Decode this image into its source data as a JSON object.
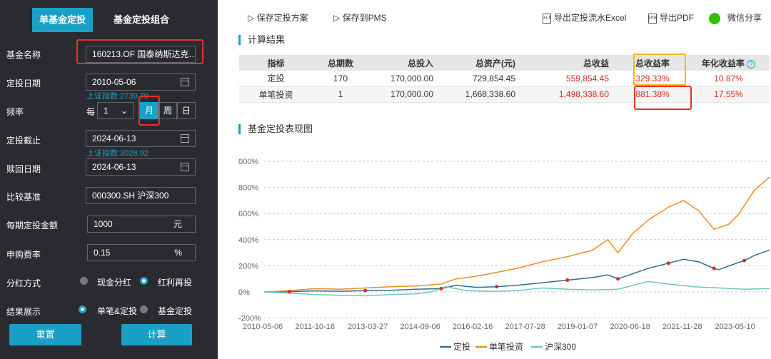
{
  "left": {
    "tabs": [
      "单基金定投",
      "基金定投组合"
    ],
    "fund_name": {
      "label": "基金名称",
      "value": "160213.OF 国泰纳斯达克…"
    },
    "start_date": {
      "label": "定投日期",
      "value": "2010-05-06",
      "hint": "上证指数:2739.70"
    },
    "frequency": {
      "label": "频率",
      "prefix": "每",
      "count": "1",
      "options": [
        "月",
        "周",
        "日"
      ],
      "selected": "月"
    },
    "end_date": {
      "label": "定投截止",
      "value": "2024-06-13",
      "hint": "上证指数:3028.92"
    },
    "redeem_date": {
      "label": "赎回日期",
      "value": "2024-06-13"
    },
    "benchmark": {
      "label": "比较基准",
      "value": "000300.SH 沪深300"
    },
    "amount": {
      "label": "每期定投金额",
      "value": "1000",
      "unit": "元"
    },
    "fee": {
      "label": "申购费率",
      "value": "0.15",
      "unit": "%"
    },
    "dividend": {
      "label": "分红方式",
      "options": [
        "现金分红",
        "红利再投"
      ],
      "selected": 1
    },
    "display": {
      "label": "结果展示",
      "options": [
        "单笔&定投",
        "基金定投"
      ],
      "selected": 0
    },
    "reset": "重置",
    "calc": "计算"
  },
  "toolbar": {
    "save_plan": "保存定投方案",
    "save_pms": "保存到PMS",
    "export_excel": "导出定投流水Excel",
    "export_pdf": "导出PDF",
    "wechat": "微信分享"
  },
  "results": {
    "title": "计算结果",
    "headers": [
      "指标",
      "总期数",
      "总投入",
      "总资产(元)",
      "总收益",
      "总收益率",
      "年化收益率"
    ],
    "rows": [
      [
        "定投",
        "170",
        "170,000.00",
        "729,854.45",
        "559,854.45",
        "329.33%",
        "10.87%"
      ],
      [
        "单笔投资",
        "1",
        "170,000.00",
        "1,668,338.60",
        "1,498,338.60",
        "881.38%",
        "17.55%"
      ]
    ]
  },
  "chart_title": "基金定投表现图",
  "colors": {
    "accent": "#1aa0c4",
    "dca": "#2e6f96",
    "lump": "#f28b1e",
    "hs300": "#6cc5c0",
    "red": "#d9282a"
  },
  "chart_data": {
    "type": "line",
    "y_ticks": [
      "800%",
      "600%",
      "400%",
      "200%",
      "0%",
      "-200%"
    ],
    "y_ticks_top": "000%",
    "x_ticks": [
      "2010-05-06",
      "2011-10-16",
      "2013-03-27",
      "2014-09-06",
      "2016-02-16",
      "2017-07-28",
      "2019-01-07",
      "2020-06-18",
      "2021-11-28",
      "2023-05-10"
    ],
    "ylim": [
      -200,
      1000
    ],
    "series": [
      {
        "name": "定投",
        "points": [
          [
            0,
            0
          ],
          [
            0.05,
            2
          ],
          [
            0.1,
            8
          ],
          [
            0.15,
            5
          ],
          [
            0.2,
            10
          ],
          [
            0.25,
            12
          ],
          [
            0.3,
            20
          ],
          [
            0.35,
            25
          ],
          [
            0.38,
            50
          ],
          [
            0.42,
            35
          ],
          [
            0.46,
            40
          ],
          [
            0.5,
            50
          ],
          [
            0.55,
            70
          ],
          [
            0.6,
            90
          ],
          [
            0.65,
            110
          ],
          [
            0.68,
            130
          ],
          [
            0.7,
            100
          ],
          [
            0.73,
            140
          ],
          [
            0.76,
            180
          ],
          [
            0.8,
            220
          ],
          [
            0.83,
            250
          ],
          [
            0.86,
            230
          ],
          [
            0.89,
            180
          ],
          [
            0.9,
            170
          ],
          [
            0.92,
            200
          ],
          [
            0.95,
            240
          ],
          [
            0.97,
            280
          ],
          [
            1,
            320
          ]
        ]
      },
      {
        "name": "单笔投资",
        "points": [
          [
            0,
            0
          ],
          [
            0.05,
            10
          ],
          [
            0.1,
            25
          ],
          [
            0.15,
            20
          ],
          [
            0.2,
            30
          ],
          [
            0.25,
            40
          ],
          [
            0.3,
            45
          ],
          [
            0.35,
            60
          ],
          [
            0.38,
            100
          ],
          [
            0.42,
            120
          ],
          [
            0.46,
            150
          ],
          [
            0.5,
            180
          ],
          [
            0.55,
            230
          ],
          [
            0.6,
            270
          ],
          [
            0.65,
            320
          ],
          [
            0.68,
            400
          ],
          [
            0.7,
            300
          ],
          [
            0.73,
            450
          ],
          [
            0.76,
            550
          ],
          [
            0.8,
            650
          ],
          [
            0.83,
            700
          ],
          [
            0.86,
            620
          ],
          [
            0.89,
            480
          ],
          [
            0.92,
            520
          ],
          [
            0.94,
            600
          ],
          [
            0.97,
            780
          ],
          [
            1,
            880
          ]
        ]
      },
      {
        "name": "沪深300",
        "points": [
          [
            0,
            0
          ],
          [
            0.05,
            -10
          ],
          [
            0.1,
            -20
          ],
          [
            0.15,
            -25
          ],
          [
            0.2,
            -30
          ],
          [
            0.25,
            -20
          ],
          [
            0.3,
            -15
          ],
          [
            0.33,
            0
          ],
          [
            0.36,
            40
          ],
          [
            0.4,
            10
          ],
          [
            0.45,
            5
          ],
          [
            0.5,
            10
          ],
          [
            0.55,
            30
          ],
          [
            0.6,
            20
          ],
          [
            0.65,
            15
          ],
          [
            0.7,
            20
          ],
          [
            0.73,
            50
          ],
          [
            0.76,
            80
          ],
          [
            0.8,
            60
          ],
          [
            0.85,
            40
          ],
          [
            0.9,
            30
          ],
          [
            0.95,
            20
          ],
          [
            1,
            25
          ]
        ]
      }
    ]
  }
}
